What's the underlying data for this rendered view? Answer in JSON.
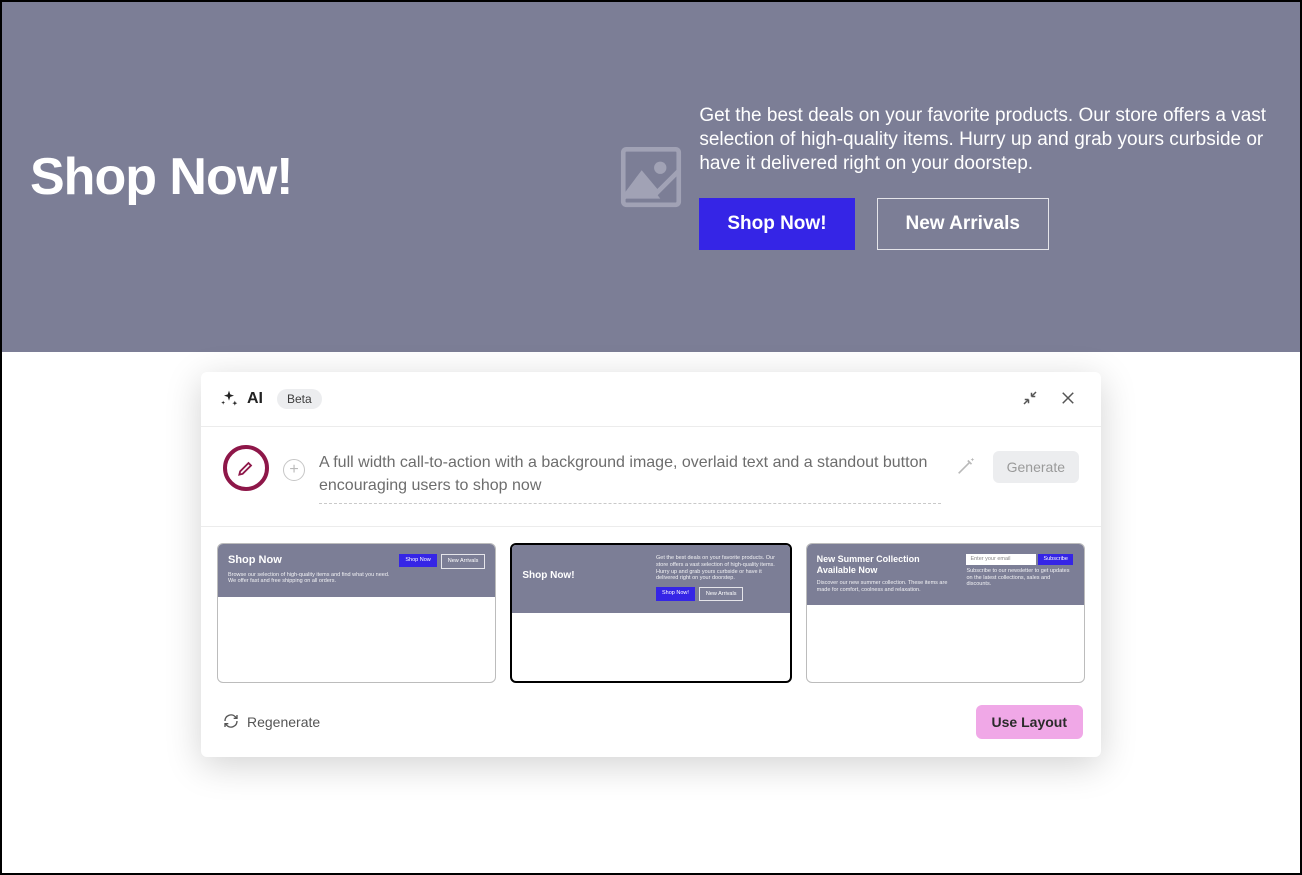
{
  "hero": {
    "title": "Shop Now!",
    "description": "Get the best deals on your favorite products. Our store offers a vast selection of high-quality items. Hurry up and grab yours curbside or have it delivered right on your doorstep.",
    "primary_button": "Shop Now!",
    "secondary_button": "New Arrivals"
  },
  "ai_panel": {
    "label": "AI",
    "badge": "Beta",
    "prompt_text": "A full width call-to-action with a background image, overlaid text and a standout button encouraging users to shop now",
    "generate_button": "Generate",
    "regenerate_button": "Regenerate",
    "use_layout_button": "Use Layout"
  },
  "layouts": [
    {
      "title": "Shop Now",
      "desc": "Browse our selection of high-quality items and find what you need. We offer fast and free shipping on all orders.",
      "btn1": "Shop Now",
      "btn2": "New Arrivals",
      "selected": false
    },
    {
      "title": "Shop Now!",
      "desc": "Get the best deals on your favorite products. Our store offers a vast selection of high-quality items. Hurry up and grab yours curbside or have it delivered right on your doorstep.",
      "btn1": "Shop Now!",
      "btn2": "New Arrivals",
      "selected": true
    },
    {
      "title": "New Summer Collection Available Now",
      "desc": "Discover our new summer collection. These items are made for comfort, coolness and relaxation.",
      "input_placeholder": "Enter your email",
      "subscribe": "Subscribe",
      "sub_desc": "Subscribe to our newsletter to get updates on the latest collections, sales and discounts.",
      "selected": false
    }
  ]
}
